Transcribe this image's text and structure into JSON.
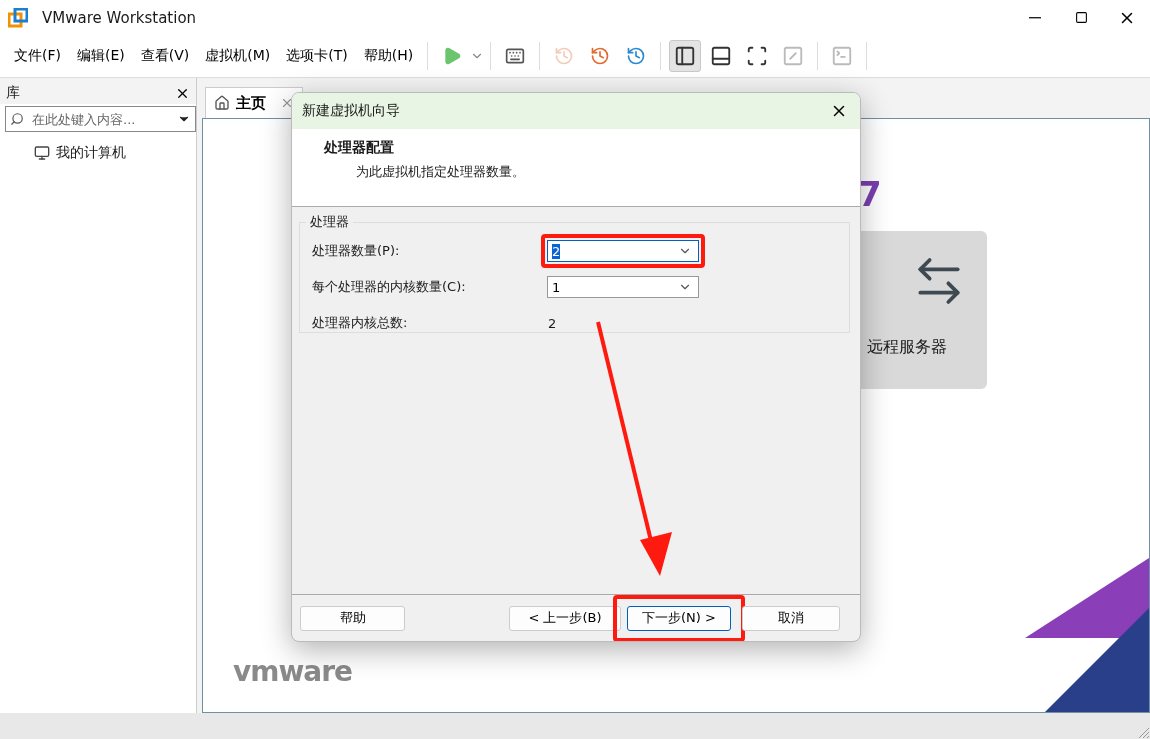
{
  "window": {
    "title": "VMware Workstation"
  },
  "menu": [
    "文件(F)",
    "编辑(E)",
    "查看(V)",
    "虚拟机(M)",
    "选项卡(T)",
    "帮助(H)"
  ],
  "toolbar": [
    {
      "kind": "play",
      "disabled": false,
      "selected": false
    },
    {
      "kind": "send-keys",
      "disabled": false,
      "selected": false
    },
    {
      "kind": "snapshot-take",
      "disabled": true,
      "selected": false
    },
    {
      "kind": "snapshot-revert",
      "disabled": false,
      "selected": false
    },
    {
      "kind": "snapshot-manage",
      "disabled": false,
      "selected": false
    },
    {
      "kind": "view-library",
      "disabled": false,
      "selected": true
    },
    {
      "kind": "view-thumbnails",
      "disabled": false,
      "selected": false
    },
    {
      "kind": "fullscreen",
      "disabled": false,
      "selected": false
    },
    {
      "kind": "unity",
      "disabled": true,
      "selected": false
    },
    {
      "kind": "console",
      "disabled": true,
      "selected": false
    }
  ],
  "library": {
    "title": "库",
    "search_placeholder": "在此处键入内容...",
    "items": [
      {
        "label": "我的计算机"
      }
    ]
  },
  "tabs": [
    {
      "label": "主页",
      "selected": true
    }
  ],
  "home": {
    "heading_fragment": "7",
    "card_label": "远程服务器",
    "logo": "vmware"
  },
  "dialog": {
    "title": "新建虚拟机向导",
    "heading": "处理器配置",
    "subheading": "为此虚拟机指定处理器数量。",
    "group": "处理器",
    "fields": [
      {
        "kind": "select",
        "label": "处理器数量(P):",
        "value": "2",
        "highlighted": true
      },
      {
        "kind": "select",
        "label": "每个处理器的内核数量(C):",
        "value": "1",
        "highlighted": false
      },
      {
        "kind": "readout",
        "label": "处理器内核总数:",
        "value": "2"
      }
    ],
    "buttons": [
      {
        "kind": "help",
        "label": "帮助",
        "highlighted": false
      },
      {
        "kind": "back",
        "label": "< 上一步(B)",
        "highlighted": false
      },
      {
        "kind": "next",
        "label": "下一步(N) >",
        "highlighted": true
      },
      {
        "kind": "cancel",
        "label": "取消",
        "highlighted": false
      }
    ]
  }
}
